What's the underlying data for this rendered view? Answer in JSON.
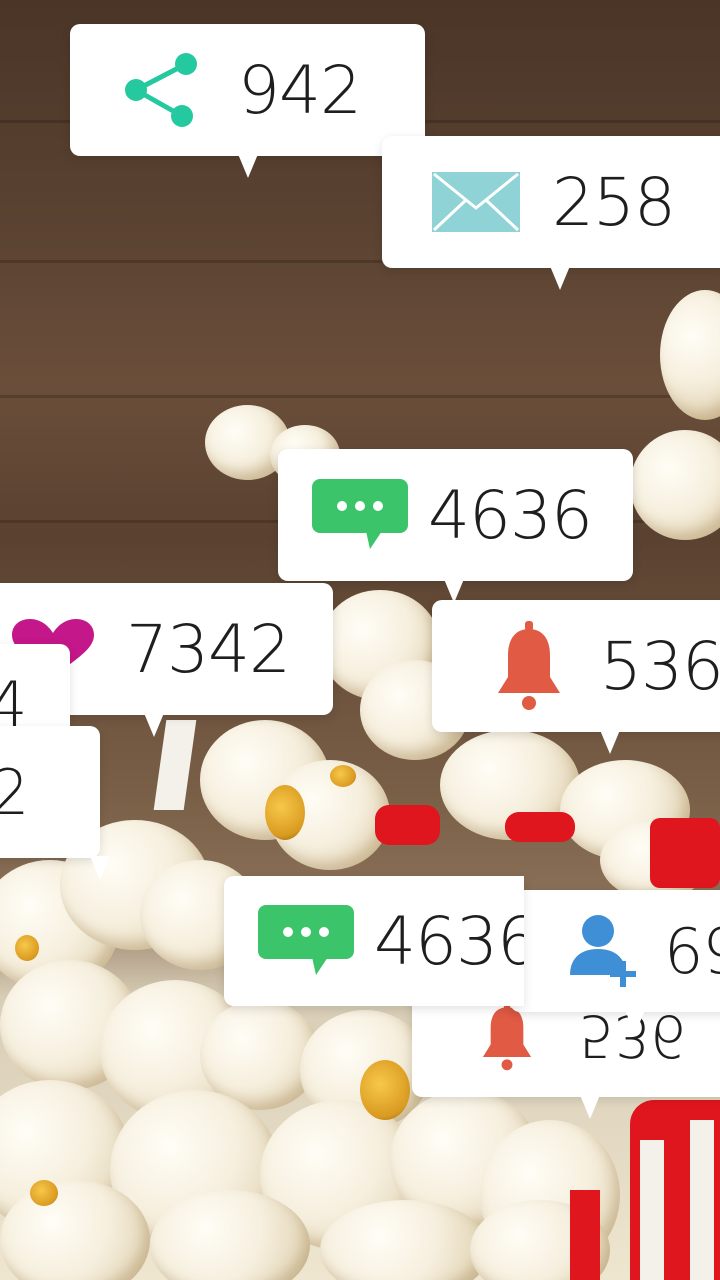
{
  "colors": {
    "share": "#25c9a0",
    "mail": "#8fd3d6",
    "comment": "#3cc46a",
    "heart": "#c4178a",
    "bell": "#e05a44",
    "follow": "#3f8fd6"
  },
  "notifications": [
    {
      "icon": "share-icon",
      "count": "942"
    },
    {
      "icon": "mail-icon",
      "count": "258"
    },
    {
      "icon": "comment-icon",
      "count": "4636"
    },
    {
      "icon": "heart-icon",
      "count": "7342"
    },
    {
      "icon": "bell-icon",
      "count": "536"
    },
    {
      "icon": "none",
      "count": "4"
    },
    {
      "icon": "none",
      "count": "2"
    },
    {
      "icon": "comment-icon",
      "count": "4636"
    },
    {
      "icon": "follow-icon",
      "count": "69"
    },
    {
      "icon": "bell-icon",
      "count": "536"
    }
  ]
}
